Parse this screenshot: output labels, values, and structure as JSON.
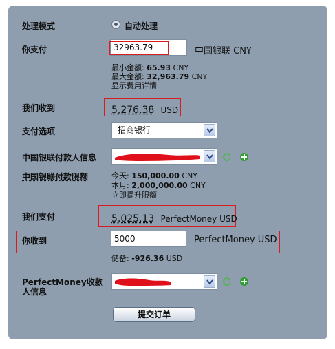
{
  "mode": {
    "label": "处理模式",
    "option": "自动处理"
  },
  "you_pay": {
    "label": "你支付",
    "amount": "32963.79",
    "currency": "中国银联 CNY",
    "min_label": "最小金额:",
    "min_value": "65.93",
    "min_unit": "CNY",
    "max_label": "最大金额:",
    "max_value": "32,963.79",
    "max_unit": "CNY",
    "fee_link": "显示费用详情"
  },
  "we_receive": {
    "label": "我们收到",
    "amount": "5,276.38",
    "currency": "USD"
  },
  "pay_option": {
    "label": "支付选项",
    "selected": "招商银行"
  },
  "payer_info": {
    "label": "中国银联付款人信息"
  },
  "limits": {
    "label": "中国银联付款限额",
    "today_label": "今天:",
    "today_value": "150,000.00",
    "today_unit": "CNY",
    "month_label": "本月:",
    "month_value": "2,000,000.00",
    "month_unit": "CNY",
    "raise_link": "立即提升限额"
  },
  "we_pay": {
    "label": "我们支付",
    "amount": "5,025.13",
    "currency": "PerfectMoney USD"
  },
  "you_receive": {
    "label": "你收到",
    "amount": "5000",
    "currency": "PerfectMoney USD",
    "reserve_label": "储备:",
    "reserve_value": "-926.36",
    "reserve_unit": "USD"
  },
  "recipient_info": {
    "label_line1": "PerfectMoney收款",
    "label_line2": "人信息"
  },
  "submit": {
    "label": "提交订单"
  },
  "colors": {
    "panel": "#8e9eaf",
    "highlight_box": "#d81b1b",
    "scribble": "#e0101a",
    "plus_icon": "#2e9e2e",
    "refresh_icon": "#57b257"
  }
}
